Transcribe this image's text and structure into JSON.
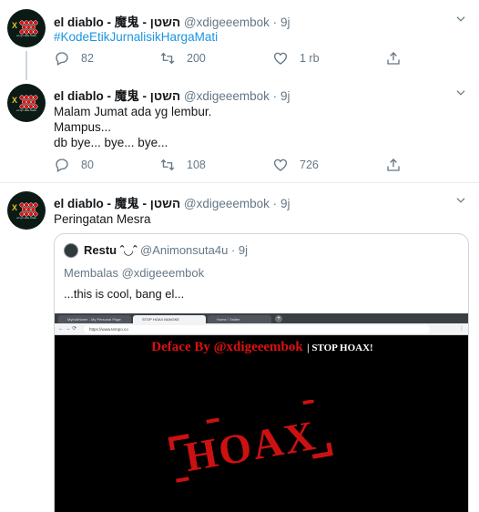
{
  "colors": {
    "accent": "#1b95e0",
    "muted": "#657786",
    "text": "#14171a",
    "deface_red": "#d11111"
  },
  "tweets": [
    {
      "name": "el diablo - 魔鬼 - השטן",
      "handle": "@xdigeeembok",
      "dot": "·",
      "time": "9j",
      "text_hashtag": "#KodeEtikJurnalisikHargaMati",
      "reply_count": "82",
      "retweet_count": "200",
      "like_count": "1 rb"
    },
    {
      "name": "el diablo - 魔鬼 - השטן",
      "handle": "@xdigeeembok",
      "dot": "·",
      "time": "9j",
      "lines": [
        "Malam Jumat ada yg lembur.",
        "Mampus...",
        "db bye... bye... bye..."
      ],
      "reply_count": "80",
      "retweet_count": "108",
      "like_count": "726"
    },
    {
      "name": "el diablo - 魔鬼 - השטן",
      "handle": "@xdigeeembok",
      "dot": "·",
      "time": "9j",
      "text": "Peringatan Mesra",
      "quote": {
        "name": "Restu ˆ◡ˆ",
        "handle": "@Animonsuta4u",
        "dot": "·",
        "time": "9j",
        "reply_to": "Membalas @xdigeeembok",
        "text": "...this is cool, bang el...",
        "screenshot": {
          "tabs": [
            "MyIndiHome - My Personal Page",
            "STOP HOAX BANGKE",
            "Home / Twitter"
          ],
          "url": "https://www.tempo.co",
          "deface_red": "Deface By @xdigeeembok",
          "deface_white": "| STOP HOAX!",
          "stamp": "HOAX"
        }
      }
    }
  ],
  "avatar_text": "el xyz elite hode"
}
